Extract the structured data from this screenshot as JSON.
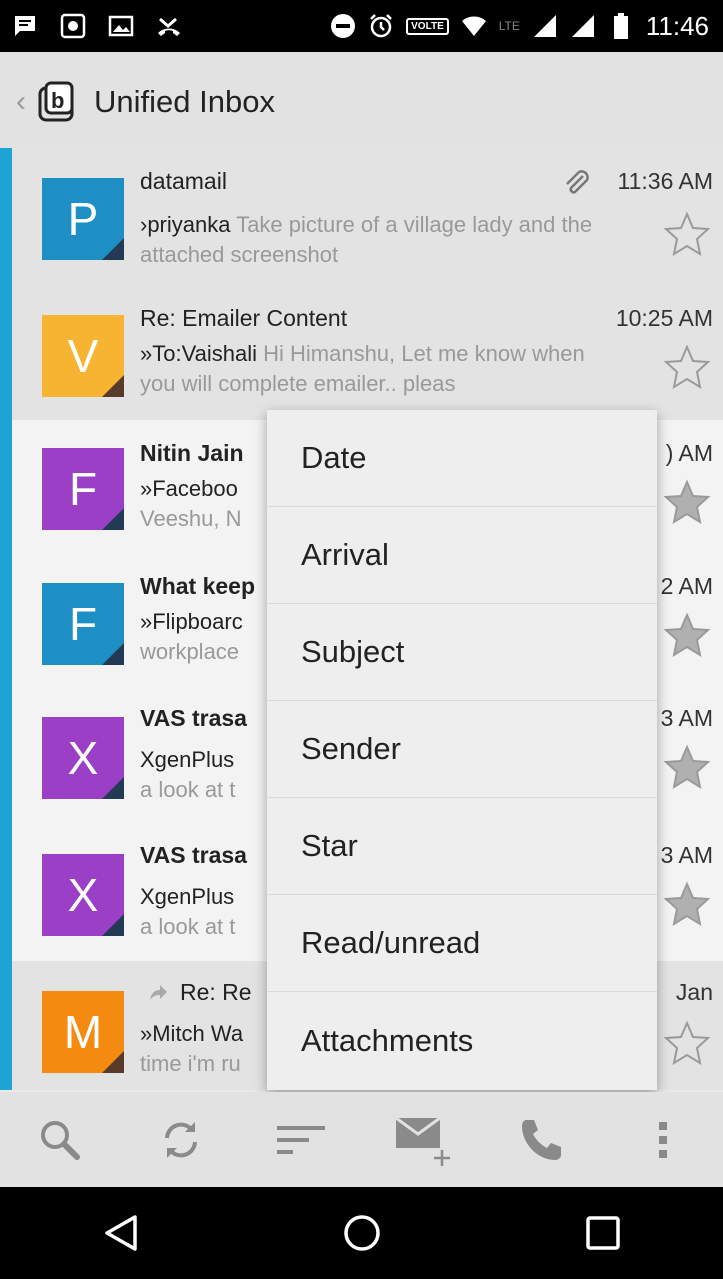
{
  "status_bar": {
    "time": "11:46",
    "volte": "VOLTE",
    "lte": "LTE"
  },
  "app_bar": {
    "title": "Unified Inbox"
  },
  "colors": {
    "accent_bar": "#1ea3d6",
    "purple": "#9b3fc6",
    "blue": "#1d8fc5",
    "yellow": "#f7b433",
    "orange": "#f58a11"
  },
  "messages": [
    {
      "avatar": "P",
      "avatar_color": "#1d8fc5",
      "subject": "datamail",
      "time": "11:36 AM",
      "preview_lead": "›priyanka",
      "preview_text": " Take picture of a village lady and the attached screenshot",
      "attachment": true
    },
    {
      "avatar": "V",
      "avatar_color": "#f7b433",
      "subject": "Re: Emailer Content",
      "time": "10:25 AM",
      "preview_lead": "»To:Vaishali",
      "preview_text": " Hi Himanshu, Let me know when you will complete emailer.. pleas"
    },
    {
      "avatar": "F",
      "avatar_color": "#9b3fc6",
      "subject": "Nitin Jain",
      "time": ") AM",
      "preview_lead": "»Faceboo",
      "preview_text": "Veeshu, N"
    },
    {
      "avatar": "F",
      "avatar_color": "#1d8fc5",
      "subject": "What keep",
      "time": "2 AM",
      "preview_lead": "»Flipboarc",
      "preview_text": "workplace"
    },
    {
      "avatar": "X",
      "avatar_color": "#9b3fc6",
      "subject": "VAS trasa",
      "time": "3 AM",
      "preview_lead": "XgenPlus",
      "preview_text": "a look at t"
    },
    {
      "avatar": "X",
      "avatar_color": "#9b3fc6",
      "subject": "VAS trasa",
      "time": "3 AM",
      "preview_lead": "XgenPlus",
      "preview_text": "a look at t"
    },
    {
      "avatar": "M",
      "avatar_color": "#f58a11",
      "subject": "Re: Re",
      "time": "Jan",
      "preview_lead": "»Mitch Wa",
      "preview_text": "time i'm ru",
      "forwarded": true
    }
  ],
  "sort_menu": {
    "items": [
      "Date",
      "Arrival",
      "Subject",
      "Sender",
      "Star",
      "Read/unread",
      "Attachments"
    ]
  }
}
